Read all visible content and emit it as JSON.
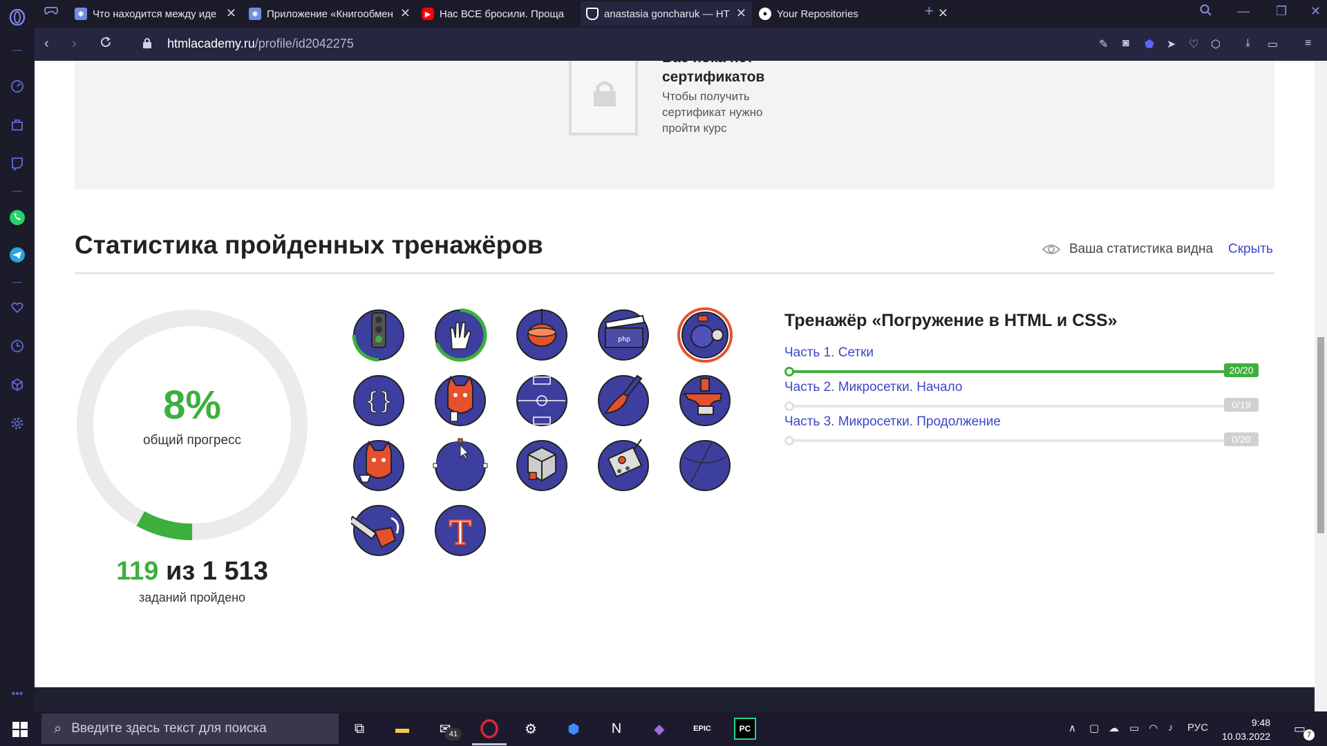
{
  "colors": {
    "green": "#3daf3d",
    "link": "#3a47c9",
    "badge_blue": "#3d3f9e",
    "badge_orange": "#e7502d",
    "opera_red": "#e0243a"
  },
  "tabs": [
    {
      "title": "Что находится между иде",
      "icon": "htmlacademy-icon"
    },
    {
      "title": "Приложение «Книгообмен",
      "icon": "htmlacademy-icon"
    },
    {
      "title": "Нас ВСЕ бросили. Проща",
      "icon": "youtube-icon"
    },
    {
      "title": "anastasia goncharuk — HT",
      "icon": "htmlacademy-shield-icon"
    },
    {
      "title": "Your Repositories",
      "icon": "github-icon"
    }
  ],
  "address": {
    "domain": "htmlacademy.ru",
    "path": "/profile/id2042275"
  },
  "certificates": {
    "title_line1": "Вас пока нет",
    "title_line2": "сертификатов",
    "desc": "Чтобы получить сертификат нужно пройти курс"
  },
  "stats": {
    "title": "Статистика пройденных тренажёров",
    "visibility_text": "Ваша статистика видна",
    "hide_link": "Скрыть",
    "percent": "8%",
    "percent_value": 0.08,
    "percent_label": "общий прогресс",
    "done_count": "119",
    "separator": "из",
    "total_count": "1 513",
    "count_label": "заданий пройдено"
  },
  "badges": [
    "traffic-light-badge",
    "hand-badge",
    "spinning-top-badge",
    "php-clapper-badge",
    "diving-helmet-badge",
    "curly-braces-badge",
    "cat-with-glass-badge",
    "football-field-badge",
    "paint-brush-badge",
    "anvil-badge",
    "cat-with-cup-badge",
    "bezier-curve-badge",
    "rubik-cube-badge",
    "robot-head-badge",
    "globe-badge",
    "chainsaw-badge",
    "letter-t-badge"
  ],
  "trainer": {
    "title": "Тренажёр «Погружение в HTML и CSS»",
    "parts": [
      {
        "label": "Часть 1. Сетки",
        "progress": "20/20",
        "value": 1.0
      },
      {
        "label": "Часть 2. Микросетки. Начало",
        "progress": "0/19",
        "value": 0
      },
      {
        "label": "Часть 3. Микросетки. Продолжение",
        "progress": "0/20",
        "value": 0
      }
    ]
  },
  "taskbar": {
    "search_placeholder": "Введите здесь текст для поиска",
    "mail_badge": "41",
    "lang": "РУС",
    "time": "9:48",
    "date": "10.03.2022",
    "notifications": "7"
  }
}
